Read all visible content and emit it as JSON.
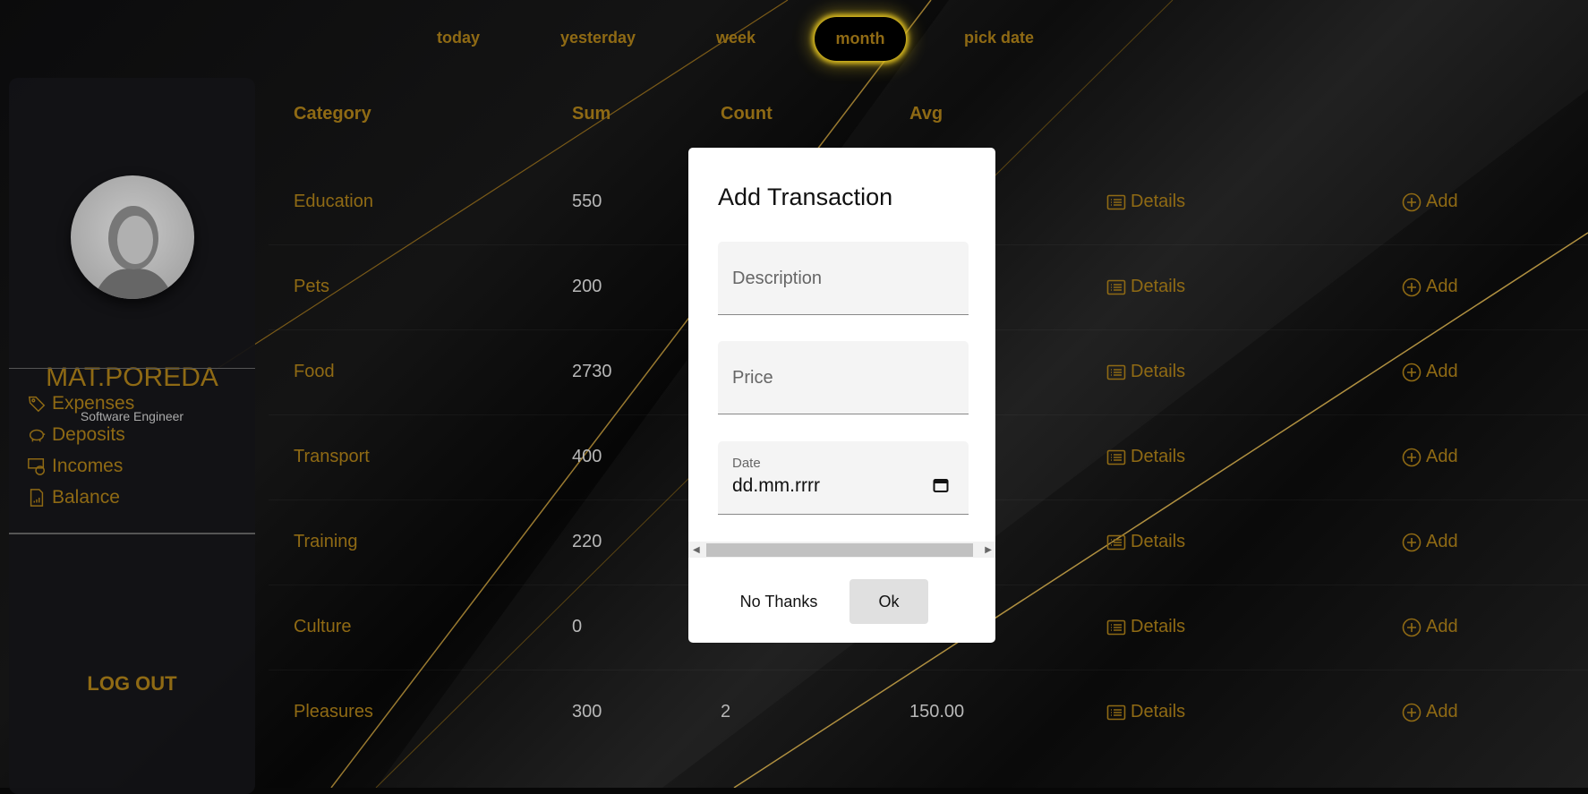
{
  "tabs": [
    "today",
    "yesterday",
    "week",
    "month",
    "pick date"
  ],
  "active_tab": "month",
  "profile": {
    "name": "MAT.POREDA",
    "role": "Software Engineer"
  },
  "nav": [
    {
      "label": "Expenses",
      "icon": "tag-icon"
    },
    {
      "label": "Deposits",
      "icon": "piggy-bank-icon"
    },
    {
      "label": "Incomes",
      "icon": "cash-coin-icon"
    },
    {
      "label": "Balance",
      "icon": "file-chart-icon"
    }
  ],
  "logout": "LOG OUT",
  "table": {
    "headers": [
      "Category",
      "Sum",
      "Count",
      "Avg"
    ],
    "details_label": "Details",
    "add_label": "Add",
    "rows": [
      {
        "category": "Education",
        "sum": "550"
      },
      {
        "category": "Pets",
        "sum": "200"
      },
      {
        "category": "Food",
        "sum": "2730"
      },
      {
        "category": "Transport",
        "sum": "400"
      },
      {
        "category": "Training",
        "sum": "220"
      },
      {
        "category": "Culture",
        "sum": "0"
      },
      {
        "category": "Pleasures",
        "sum": "300",
        "count": "2",
        "avg": "150.00"
      }
    ]
  },
  "modal": {
    "title": "Add Transaction",
    "description_placeholder": "Description",
    "price_placeholder": "Price",
    "date_label": "Date",
    "date_value": "dd.mm.rrrr",
    "cancel": "No Thanks",
    "ok": "Ok"
  },
  "colors": {
    "gold": "#8f6a14",
    "glow": "#e0c020"
  }
}
